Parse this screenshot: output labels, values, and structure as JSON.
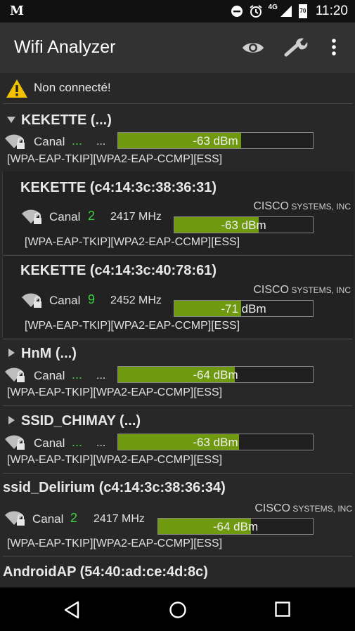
{
  "statusbar": {
    "carrier_icon": "M",
    "network": "4G",
    "battery": "70",
    "time": "11:20"
  },
  "toolbar": {
    "title": "Wifi Analyzer"
  },
  "connection": {
    "text": "Non connecté!"
  },
  "groups": [
    {
      "name": "KEKETTE (...)",
      "channel": "...",
      "freq": "...",
      "signal": "-63 dBm",
      "level": 0.63,
      "security": "[WPA-EAP-TKIP][WPA2-EAP-CCMP][ESS]",
      "children": [
        {
          "name": "KEKETTE (c4:14:3c:38:36:31)",
          "vendor_main": "CISCO",
          "vendor_rest": " SYSTEMS, INC",
          "channel": "2",
          "freq": "2417 MHz",
          "signal": "-63 dBm",
          "level": 0.61,
          "security": "[WPA-EAP-TKIP][WPA2-EAP-CCMP][ESS]"
        },
        {
          "name": "KEKETTE (c4:14:3c:40:78:61)",
          "vendor_main": "CISCO",
          "vendor_rest": " SYSTEMS, INC",
          "channel": "9",
          "freq": "2452 MHz",
          "signal": "-71 dBm",
          "level": 0.48,
          "security": "[WPA-EAP-TKIP][WPA2-EAP-CCMP][ESS]"
        }
      ]
    },
    {
      "name": "HnM (...)",
      "channel": "...",
      "freq": "...",
      "signal": "-64 dBm",
      "level": 0.6,
      "security": "[WPA-EAP-TKIP][WPA2-EAP-CCMP][ESS]"
    },
    {
      "name": "SSID_CHIMAY (...)",
      "channel": "...",
      "freq": "...",
      "signal": "-63 dBm",
      "level": 0.62,
      "security": "[WPA-EAP-TKIP][WPA2-EAP-CCMP][ESS]"
    },
    {
      "name": "ssid_Delirium (c4:14:3c:38:36:34)",
      "vendor_main": "CISCO",
      "vendor_rest": " SYSTEMS, INC",
      "channel": "2",
      "freq": "2417 MHz",
      "signal": "-64 dBm",
      "level": 0.6,
      "security": "[WPA-EAP-TKIP][WPA2-EAP-CCMP][ESS]"
    },
    {
      "name": "AndroidAP (54:40:ad:ce:4d:8c)"
    }
  ],
  "label_canal": "Canal",
  "colors": {
    "bar_fill": "#6f9a0f",
    "channel": "#3ed13e",
    "toolbar": "#323232"
  }
}
